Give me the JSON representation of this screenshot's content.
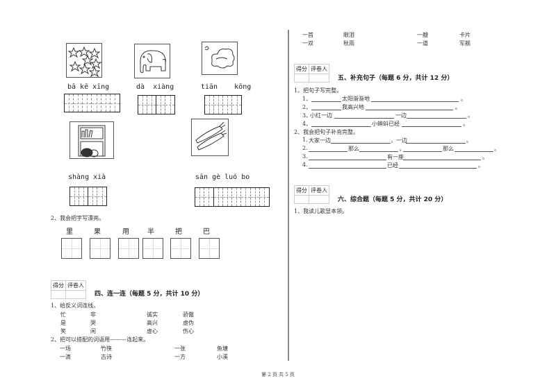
{
  "left": {
    "pictures": [
      {
        "name": "stars",
        "pinyin": "bā kē xīng",
        "cells": 6
      },
      {
        "name": "elephant",
        "pinyin": "dà  xiàng",
        "cells": 4
      },
      {
        "name": "sky",
        "pinyin": "tiān    kōng",
        "cells": 4
      },
      {
        "name": "shelf",
        "pinyin": "shàng xià",
        "cells": 4
      },
      {
        "name": "carrots",
        "pinyin": "sān gè luó bo",
        "cells": 8
      }
    ],
    "q2": {
      "prompt": "2、我会把字写漂亮。",
      "chars": [
        "里",
        "果",
        "用",
        "半",
        "把",
        "巴"
      ]
    },
    "section4": {
      "score_headers": [
        "得分",
        "评卷人"
      ],
      "title": "四、连一连（每题 5 分，共计 10 分）",
      "q1_prompt": "1、给反义词连线。",
      "q1_rows": [
        [
          "忙",
          "非",
          "诚实",
          "骄傲"
        ],
        [
          "是",
          "哭",
          "高兴",
          "虚伪"
        ],
        [
          "笑",
          "闲",
          "虚心",
          "伤心"
        ]
      ],
      "q2_prompt": "2、把可以搭配的词语用———连起来。",
      "q2_rows": [
        [
          "一场",
          "竹筷",
          "一张",
          "鱼塘"
        ],
        [
          "一滴",
          "古诗",
          "一方",
          "小溪"
        ]
      ]
    }
  },
  "right": {
    "top_rows": [
      [
        "一首",
        "眼泪",
        "一艘",
        "卡片"
      ],
      [
        "一双",
        "秋雨",
        "一道",
        "军舰"
      ]
    ],
    "section5": {
      "score_headers": [
        "得分",
        "评卷人"
      ],
      "title": "五、补充句子（每题 6 分，共计 12 分）",
      "q1_prompt": "1、把句子写完整。",
      "q1_items": [
        {
          "num": "1、",
          "parts": [
            "",
            "太阳渐渐地",
            "。"
          ]
        },
        {
          "num": "2、",
          "parts": [
            "",
            "我高兴地",
            "。"
          ]
        },
        {
          "num": "3、",
          "parts": [
            "小红一边",
            "一边",
            "。"
          ]
        },
        {
          "num": "4、",
          "parts": [
            "",
            "小蝌蚪已经",
            "。"
          ]
        }
      ],
      "q2_prompt": "2、我会把句子补充完整。",
      "q2_items": [
        {
          "num": "1.",
          "parts": [
            "大家一边",
            "，一边",
            "。"
          ]
        },
        {
          "num": "2.",
          "parts": [
            "",
            "那么",
            "，",
            "那么",
            "。"
          ]
        },
        {
          "num": "3.",
          "parts": [
            "",
            "有一座",
            "。"
          ]
        },
        {
          "num": "4.",
          "parts": [
            "",
            "已经",
            "。"
          ]
        }
      ]
    },
    "section6": {
      "score_headers": [
        "得分",
        "评卷人"
      ],
      "title": "六、综合题（每题 5 分，共计 20 分）",
      "q1_prompt": "1、我读儿歌显本领。"
    }
  },
  "footer": "第 2 页 共 5 页"
}
